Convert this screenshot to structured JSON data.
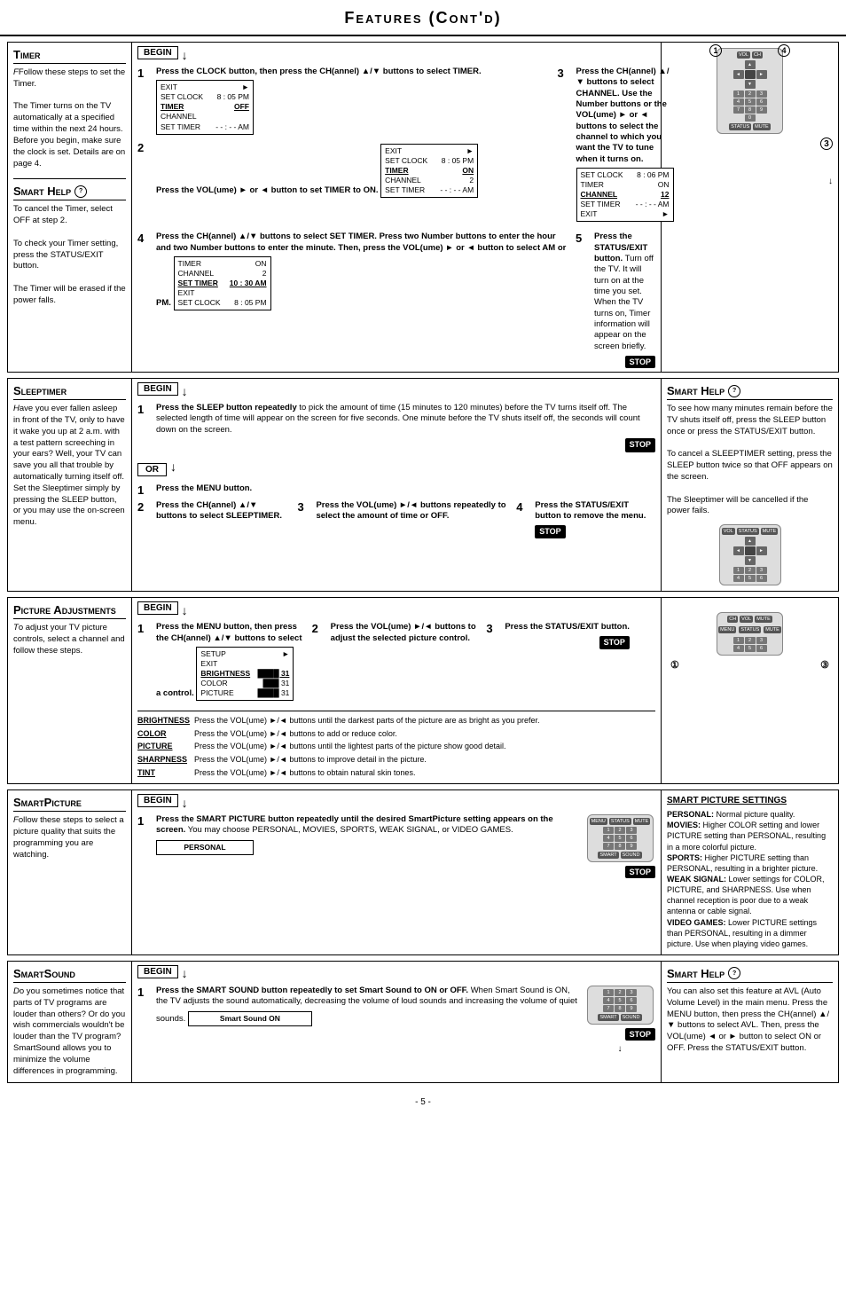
{
  "page": {
    "title": "Features (Cont'd)",
    "page_number": "- 5 -"
  },
  "sections": {
    "timer": {
      "label": "Timer",
      "intro": "Follow these steps to set the Timer.",
      "body": "The Timer turns on the TV automatically at a specified time within the next 24 hours.\nBefore you begin, make sure the clock is set. Details are on page 4.",
      "steps": [
        {
          "num": "1",
          "text": "Press the CLOCK button, then press the CH(annel) ▲/▼ buttons to select TIMER."
        },
        {
          "num": "2",
          "text": "Press the VOL(ume) ► or ◄ button to set TIMER to ON."
        },
        {
          "num": "3",
          "text": "Press the CH(annel) ▲/▼ buttons to select CHANNEL. Use the Number buttons or the VOL(ume) ► or ◄ buttons to select the channel to which you want the TV to tune when it turns on."
        },
        {
          "num": "4",
          "text": "Press the CH(annel) ▲/▼ buttons to select SET TIMER. Press two Number buttons to enter the hour and two Number buttons to enter the minute. Then, press the VOL(ume) ► or ◄ button to select AM or PM."
        },
        {
          "num": "5",
          "text": "Press the STATUS/EXIT button. Turn off the TV. It will turn on at the time you set. When the TV turns on, Timer information will appear on the screen briefly."
        }
      ],
      "menu1": {
        "rows": [
          {
            "label": "EXIT",
            "value": "►"
          },
          {
            "label": "SET CLOCK",
            "value": "8 : 05 PM"
          },
          {
            "label": "TIMER",
            "value": "OFF"
          },
          {
            "label": "CHANNEL",
            "value": ""
          },
          {
            "label": "SET TIMER",
            "value": "- - : - - AM"
          }
        ],
        "highlighted": "TIMER"
      },
      "menu2": {
        "rows": [
          {
            "label": "EXIT",
            "value": ""
          },
          {
            "label": "SET CLOCK",
            "value": "8 : 05 PM"
          },
          {
            "label": "TIMER",
            "value": "ON"
          },
          {
            "label": "CHANNEL",
            "value": "2"
          },
          {
            "label": "SET TIMER",
            "value": "- - : - - AM"
          }
        ],
        "highlighted": "TIMER"
      },
      "menu3": {
        "rows": [
          {
            "label": "SET CLOCK",
            "value": "8 : 06 PM"
          },
          {
            "label": "TIMER",
            "value": "ON"
          },
          {
            "label": "CHANNEL",
            "value": "12"
          },
          {
            "label": "SET TIMER",
            "value": "- - : - - AM"
          },
          {
            "label": "EXIT",
            "value": "►"
          }
        ],
        "highlighted": "CHANNEL"
      },
      "menu4": {
        "rows": [
          {
            "label": "TIMER",
            "value": "ON"
          },
          {
            "label": "CHANNEL",
            "value": "2"
          },
          {
            "label": "SET TIMER",
            "value": "10 : 30 AM"
          },
          {
            "label": "EXIT",
            "value": ""
          },
          {
            "label": "SET CLOCK",
            "value": "8 : 05 PM"
          }
        ],
        "highlighted": "SET TIMER"
      },
      "smart_help_label": "Smart Help",
      "smart_help_text": "To cancel the Timer, select OFF at step 2.\n\nTo check your Timer setting, press the STATUS/EXIT button.\n\nThe Timer will be erased if the power falls."
    },
    "sleeptimer": {
      "label": "Sleeptimer",
      "intro": "Have you ever fallen asleep in front of the TV, only to have it wake you up at 2 a.m. with a test pattern screeching in your ears? Well, your TV can save you all that trouble by automatically turning itself off. Set the Sleeptimer simply by pressing the SLEEP button, or you may use the on-screen menu.",
      "steps": [
        {
          "num": "1",
          "text": "Press the SLEEP button repeatedly to pick the amount of time (15 minutes to 120 minutes) before the TV turns itself off. The selected length of time will appear on the screen for five seconds. One minute before the TV shuts itself off, the seconds will count down on the screen."
        },
        {
          "num": "OR",
          "text": ""
        },
        {
          "num": "1",
          "text": "Press the MENU button."
        },
        {
          "num": "2",
          "text": "Press the CH(annel) ▲/▼ buttons to select SLEEPTIMER."
        },
        {
          "num": "3",
          "text": "Press the VOL(ume) ►/◄ buttons repeatedly to select the amount of time or OFF."
        },
        {
          "num": "4",
          "text": "Press the STATUS/EXIT button to remove the menu."
        }
      ],
      "smart_help_label": "Smart Help",
      "smart_help_text": "To see how many minutes remain before the TV shuts itself off, press the SLEEP button once or press the STATUS/EXIT button.\n\nTo cancel a SLEEPTIMER setting, press the SLEEP button twice so that OFF appears on the screen.\n\nThe Sleeptimer will be cancelled if the power fails."
    },
    "picture": {
      "label": "Picture Adjustments",
      "intro": "To adjust your TV picture controls, select a channel and follow these steps.",
      "steps": [
        {
          "num": "1",
          "text": "Press the MENU button, then press the CH(annel) ▲/▼ buttons to select a control."
        },
        {
          "num": "2",
          "text": "Press the VOL(ume) ►/◄ buttons to adjust the selected picture control."
        },
        {
          "num": "3",
          "text": "Press the STATUS/EXIT button."
        }
      ],
      "menu_pic": {
        "rows": [
          {
            "label": "SETUP",
            "value": "►"
          },
          {
            "label": "EXIT",
            "value": ""
          },
          {
            "label": "BRIGHTNESS",
            "value": "████ 31"
          },
          {
            "label": "COLOR",
            "value": "███ 31"
          },
          {
            "label": "PICTURE",
            "value": "████ 31"
          }
        ],
        "highlighted": "BRIGHTNESS"
      },
      "adjustments": [
        {
          "label": "BRIGHTNESS",
          "desc": "Press the VOL(ume) ►/◄ buttons until the darkest parts of the picture are as bright as you prefer."
        },
        {
          "label": "COLOR",
          "desc": "Press the VOL(ume) ►/◄ buttons to add or reduce color."
        },
        {
          "label": "PICTURE",
          "desc": "Press the VOL(ume) ►/◄ buttons until the lightest parts of the picture show good detail."
        },
        {
          "label": "SHARPNESS",
          "desc": "Press the VOL(ume) ►/◄ buttons to improve detail in the picture."
        },
        {
          "label": "TINT",
          "desc": "Press the VOL(ume) ►/◄ buttons to obtain natural skin tones."
        }
      ]
    },
    "smartpicture": {
      "label": "SmartPicture",
      "intro": "Follow these steps to select a picture quality that suits the programming you are watching.",
      "steps": [
        {
          "num": "1",
          "text": "Press the SMART PICTURE button repeatedly until the desired SmartPicture setting appears on the screen. You may choose PERSONAL, MOVIES, SPORTS, WEAK SIGNAL, or VIDEO GAMES."
        }
      ],
      "screen_display": "PERSONAL",
      "settings_title": "SMART PICTURE SETTINGS",
      "settings": [
        {
          "label": "PERSONAL:",
          "desc": "Normal picture quality."
        },
        {
          "label": "MOVIES:",
          "desc": "Higher COLOR setting and lower PICTURE setting than PERSONAL, resulting in a more colorful picture."
        },
        {
          "label": "SPORTS:",
          "desc": "Higher PICTURE setting than PERSONAL, resulting in a brighter picture."
        },
        {
          "label": "WEAK SIGNAL:",
          "desc": "Lower settings for COLOR, PICTURE, and SHARPNESS. Use when channel reception is poor due to a weak antenna or cable signal."
        },
        {
          "label": "VIDEO GAMES:",
          "desc": "Lower PICTURE settings than PERSONAL, resulting in a dimmer picture. Use when playing video games."
        }
      ]
    },
    "smartsound": {
      "label": "SmartSound",
      "intro": "Do you sometimes notice that parts of TV programs are louder than others? Or do you wish commercials wouldn't be louder than the TV program? SmartSound allows you to minimize the volume differences in programming.",
      "steps": [
        {
          "num": "1",
          "text": "Press the SMART SOUND button repeatedly to set Smart Sound to ON or OFF. When Smart Sound is ON, the TV adjusts the sound automatically, decreasing the volume of loud sounds and increasing the volume of quiet sounds."
        }
      ],
      "screen_display": "Smart Sound   ON",
      "smart_help_label": "Smart Help",
      "smart_help_text": "You can also set this feature at AVL (Auto Volume Level) in the main menu. Press the MENU button, then press the CH(annel) ▲/▼ buttons to select AVL. Then, press the VOL(ume) ◄ or ► button to select ON or OFF. Press the STATUS/EXIT button."
    }
  }
}
